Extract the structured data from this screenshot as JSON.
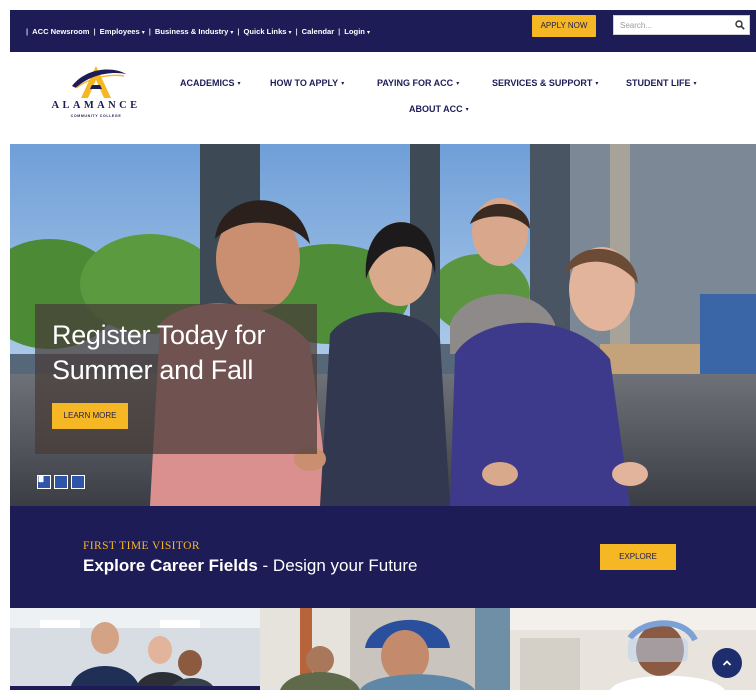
{
  "utility_bar": {
    "links": [
      {
        "label": "ACC Newsroom",
        "dropdown": false
      },
      {
        "label": "Employees",
        "dropdown": true
      },
      {
        "label": "Business & Industry",
        "dropdown": true
      },
      {
        "label": "Quick Links",
        "dropdown": true
      },
      {
        "label": "Calendar",
        "dropdown": false
      },
      {
        "label": "Login",
        "dropdown": true
      }
    ],
    "separator": "|",
    "apply_label": "APPLY NOW",
    "search_placeholder": "Search..."
  },
  "header": {
    "logo_text": "ALAMANCE",
    "logo_subtext": "COMMUNITY COLLEGE",
    "nav": [
      {
        "label": "ACADEMICS",
        "dropdown": true
      },
      {
        "label": "HOW TO APPLY",
        "dropdown": true
      },
      {
        "label": "PAYING FOR ACC",
        "dropdown": true
      },
      {
        "label": "SERVICES & SUPPORT",
        "dropdown": true
      },
      {
        "label": "STUDENT LIFE",
        "dropdown": true
      },
      {
        "label": "ABOUT ACC",
        "dropdown": true
      }
    ]
  },
  "hero": {
    "heading": "Register Today for Summer and Fall",
    "button_label": "LEARN MORE",
    "controls": [
      "previous",
      "pause",
      "next"
    ]
  },
  "visitor": {
    "label": "FIRST TIME VISITOR",
    "highlight": "Explore Career Fields",
    "rest": " - Design your Future",
    "button_label": "EXPLORE"
  },
  "icons": {
    "caret": "▾",
    "prev": "previous-icon",
    "pause": "pause-icon",
    "next": "next-icon",
    "search": "search-icon",
    "back_to_top": "chevron-up-icon"
  },
  "colors": {
    "navy": "#1e1c57",
    "gold": "#f5b724",
    "slider_blue": "#2f55a8"
  }
}
